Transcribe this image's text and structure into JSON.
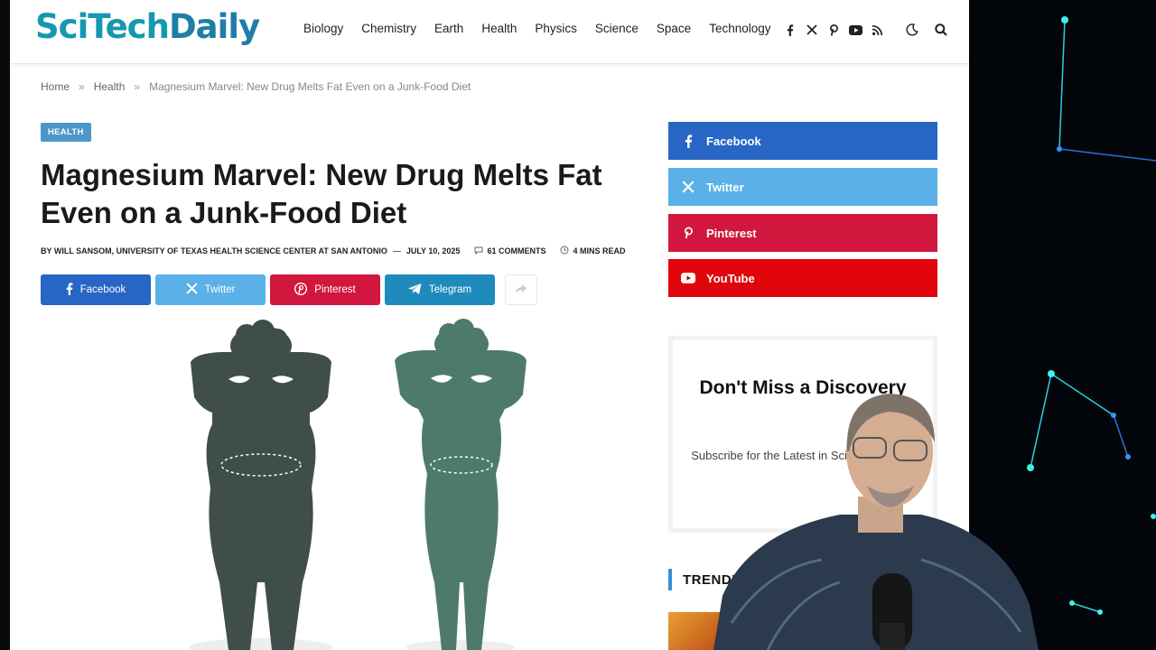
{
  "site": {
    "logo_part1": "Sci",
    "logo_part2": "Tech",
    "logo_part3": "Daily"
  },
  "nav": {
    "items": [
      {
        "label": "Biology"
      },
      {
        "label": "Chemistry"
      },
      {
        "label": "Earth"
      },
      {
        "label": "Health"
      },
      {
        "label": "Physics"
      },
      {
        "label": "Science"
      },
      {
        "label": "Space"
      },
      {
        "label": "Technology"
      }
    ],
    "social_icons": [
      "facebook-icon",
      "x-icon",
      "pinterest-icon",
      "youtube-icon",
      "rss-icon"
    ],
    "tool_icons": [
      "dark-mode-icon",
      "search-icon"
    ]
  },
  "breadcrumb": {
    "home": "Home",
    "sep": "»",
    "section": "Health",
    "current": "Magnesium Marvel: New Drug Melts Fat Even on a Junk-Food Diet"
  },
  "article": {
    "category": "HEALTH",
    "title": "Magnesium Marvel: New Drug Melts Fat Even on a Junk-Food Diet",
    "author": "BY WILL SANSOM, UNIVERSITY OF TEXAS HEALTH SCIENCE CENTER AT SAN ANTONIO",
    "dash": "—",
    "date": "JULY 10, 2025",
    "comments": "61 COMMENTS",
    "read_time": "4 MINS READ"
  },
  "share": {
    "buttons": [
      {
        "label": "Facebook",
        "color": "#2766c5",
        "icon": "facebook-icon"
      },
      {
        "label": "Twitter",
        "color": "#5bb0e8",
        "icon": "x-icon"
      },
      {
        "label": "Pinterest",
        "color": "#d1173d",
        "icon": "pinterest-icon"
      },
      {
        "label": "Telegram",
        "color": "#1f8bbd",
        "icon": "telegram-icon"
      }
    ]
  },
  "sidebar": {
    "social": [
      {
        "label": "Facebook",
        "color": "#2766c5",
        "icon": "facebook-icon"
      },
      {
        "label": "Twitter",
        "color": "#5bb0e8",
        "icon": "x-icon"
      },
      {
        "label": "Pinterest",
        "color": "#d1173d",
        "icon": "pinterest-icon"
      },
      {
        "label": "YouTube",
        "color": "#e0050b",
        "icon": "youtube-icon"
      }
    ],
    "newsletter": {
      "heading": "Don't Miss a Discovery",
      "subtext": "Subscribe for the Latest in Science & Tech!"
    },
    "trending": "TRENDING"
  },
  "colors": {
    "accent": "#4d96c9",
    "figure_before": "#3f4e4b",
    "figure_after": "#4d7a6c"
  }
}
